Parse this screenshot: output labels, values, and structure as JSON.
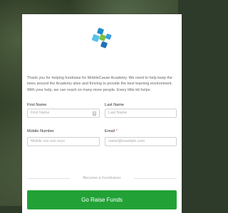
{
  "form": {
    "intro": "Thank you for helping fundraise for MobileCause Academy. We need to help keep the trees around the Academy alive and thriving to provide the best learning environment. With your help, we can reach so many more people. Every little bit helps.",
    "first_name": {
      "label": "First Name",
      "placeholder": "First Name"
    },
    "last_name": {
      "label": "Last Name",
      "placeholder": "Last Name"
    },
    "mobile": {
      "label": "Mobile Number",
      "placeholder": "Mobile xxx-xxx-xxxx"
    },
    "email": {
      "label": "Email",
      "required_mark": "*",
      "placeholder": "name@example.com"
    },
    "divider_text": "Become a Fundraiser",
    "submit_label": "Go Raise Funds"
  },
  "colors": {
    "primary_green": "#22a236",
    "required_red": "#d9534f"
  },
  "icons": {
    "logo": "mobilecause-logo",
    "first_name_field": "contact-card-icon"
  }
}
